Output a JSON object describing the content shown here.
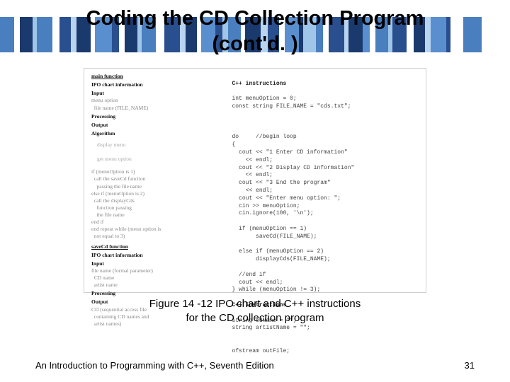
{
  "title_line1": "Coding the CD Collection Program",
  "title_line2": "(cont'd. )",
  "ipo": {
    "main_heading": "main function",
    "chart_info": "IPO chart information",
    "input_label": "Input",
    "input_items": "menu option\n  file name (FILE_NAME)",
    "processing_label": "Processing",
    "processing_items": "",
    "output_label": "Output",
    "output_items": "",
    "algorithm_label": "Algorithm",
    "algo_faint1": "display menu",
    "algo_faint2": "get menu option",
    "algo_block": "if (menuOption is 1)\n  call the saveCd function\n    passing the file name\nelse if (menuOption is 2)\n  call the displayCds\n    function passing\n    the file name\nend if\nend repeat while (menu option is\n  not equal to 3)",
    "savecd_heading": "saveCd function",
    "chart_info2": "IPO chart information",
    "input_label2": "Input",
    "input_items2": "file name (formal parameter)\n  CD name\n  artist name",
    "processing_label2": "Processing",
    "output_label2": "Output",
    "output_items2": "CD (sequential access file\n  containing CD names and\n  artist names)"
  },
  "code": {
    "heading": "C++ instructions",
    "decl": "int menuOption = 0;\nconst string FILE_NAME = \"cds.txt\";",
    "loop": "do     //begin loop\n{\n  cout << \"1 Enter CD information\"\n    << endl;\n  cout << \"2 Display CD information\"\n    << endl;\n  cout << \"3 End the program\"\n    << endl;\n  cout << \"Enter menu option: \";\n  cin >> menuOption;\n  cin.ignore(100, '\\n');\n\n  if (menuOption == 1)\n       saveCd(FILE_NAME);\n\n  else if (menuOption == 2)\n       displayCds(FILE_NAME);\n\n  //end if\n  cout << endl;\n} while (menuOption != 3);",
    "heading2": "C++ instructions",
    "decl2": "string cdName = \"\";\nstring artistName = \"\";",
    "out": "ofstream outFile;"
  },
  "caption_line1": "Figure 14 -12 IPO chart and C++ instructions",
  "caption_line2": "for the CD collection program",
  "footer_left": "An Introduction to Programming with C++, Seventh Edition",
  "page_number": "31"
}
